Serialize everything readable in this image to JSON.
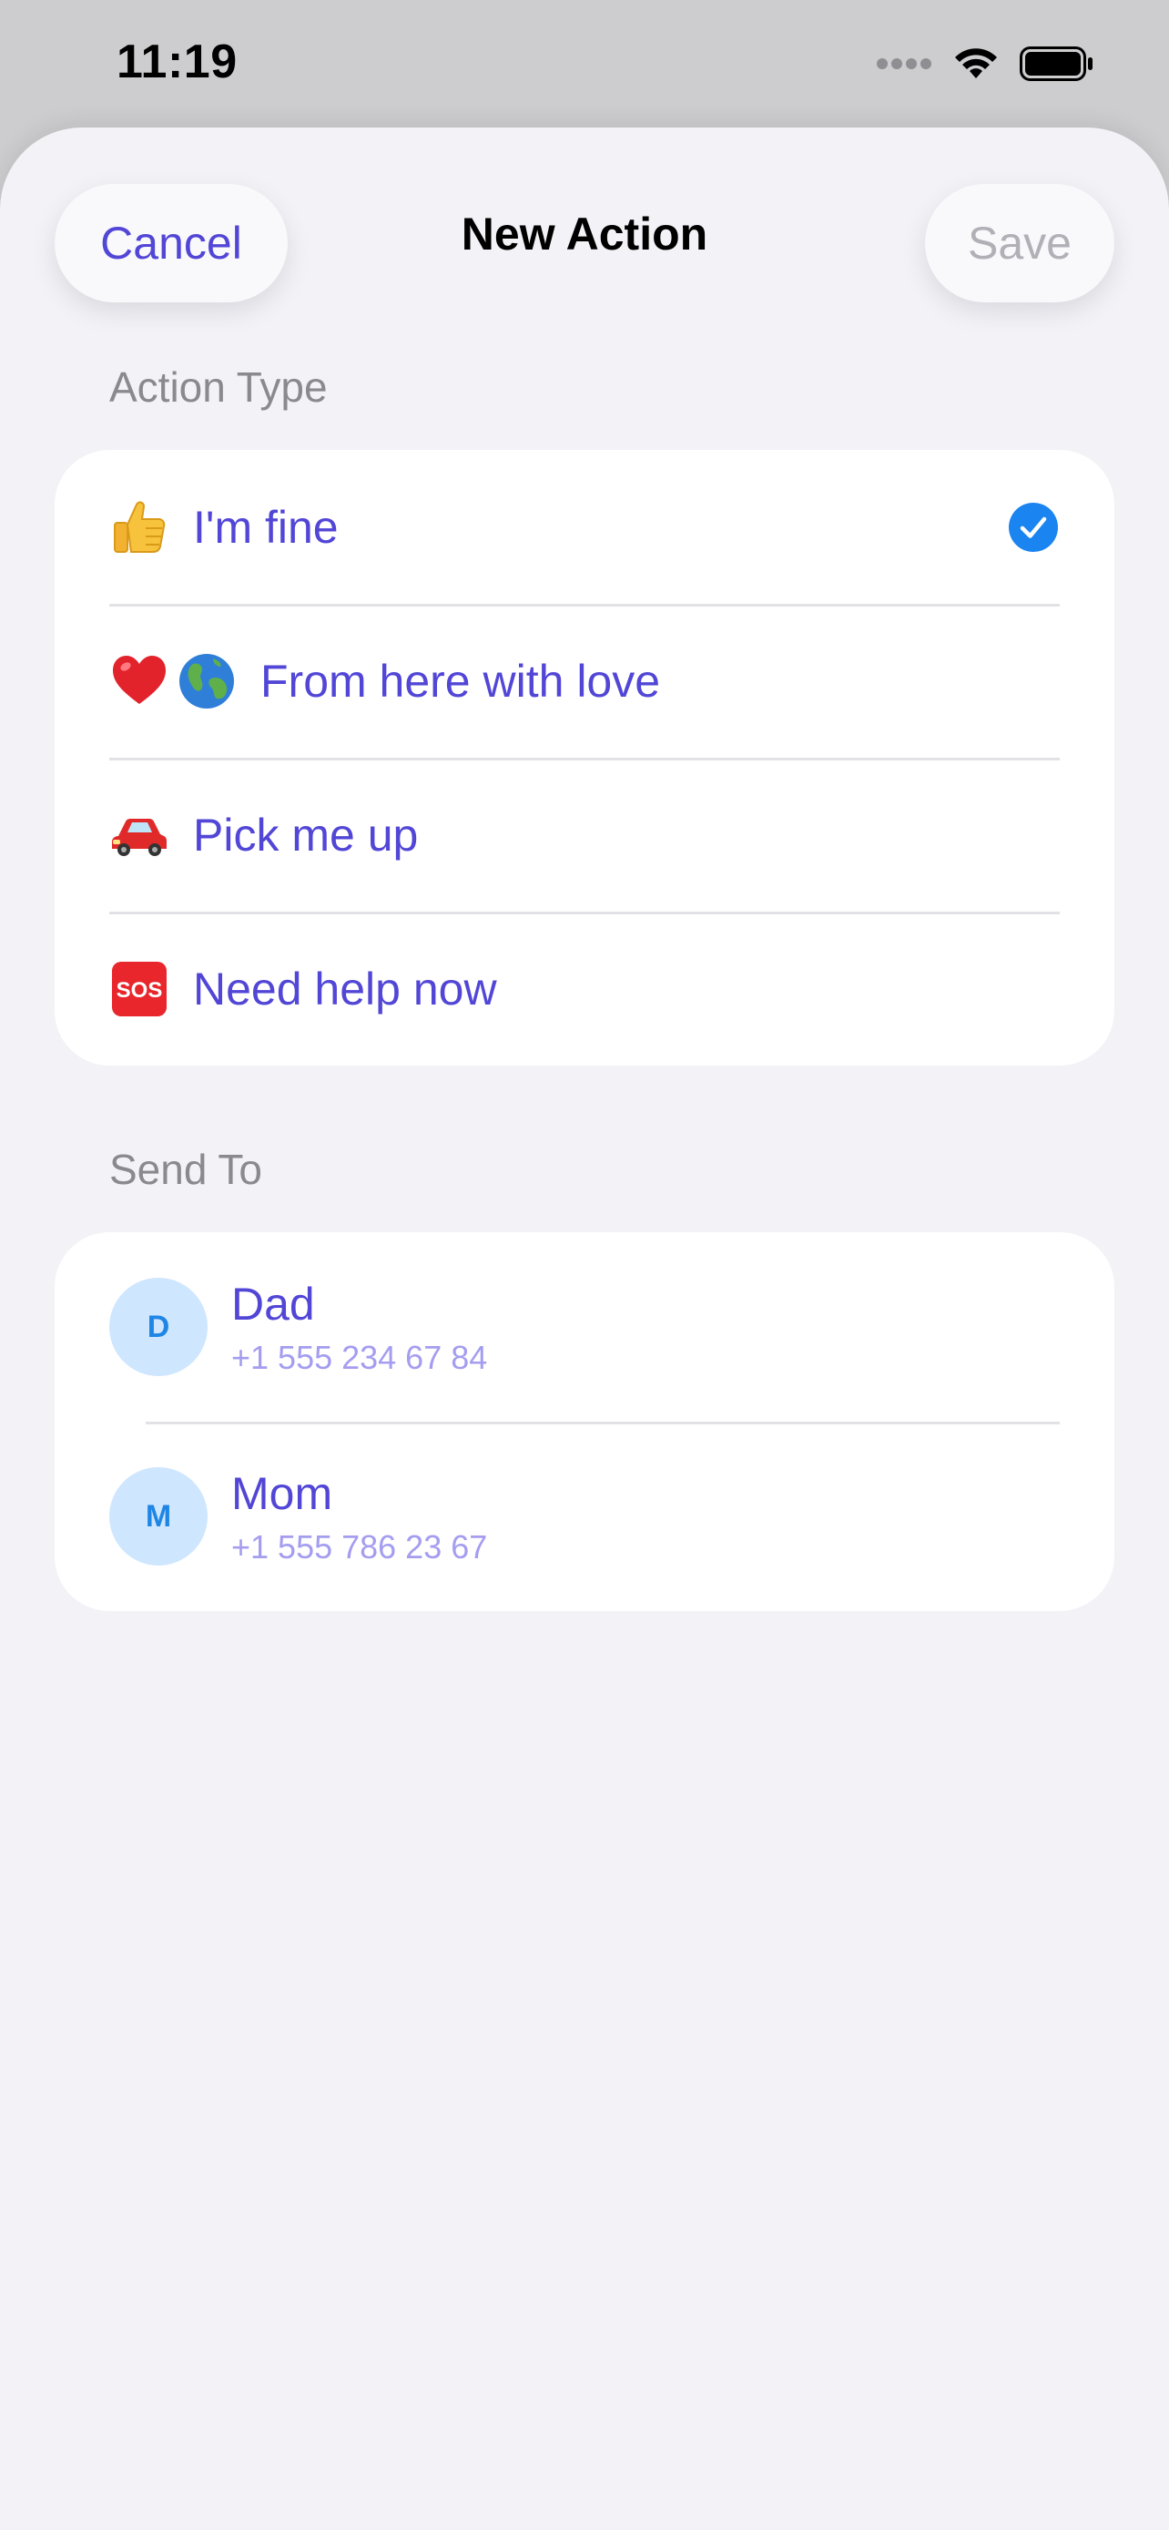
{
  "status_bar": {
    "time": "11:19",
    "icons": [
      "signal-dots-icon",
      "wifi-icon",
      "battery-icon"
    ]
  },
  "nav": {
    "cancel_label": "Cancel",
    "title": "New Action",
    "save_label": "Save"
  },
  "action_type": {
    "header": "Action Type",
    "items": [
      {
        "icons": [
          "thumbs-up-icon"
        ],
        "label": "I'm fine",
        "selected": true
      },
      {
        "icons": [
          "red-heart-icon",
          "globe-icon"
        ],
        "label": "From here with love",
        "selected": false
      },
      {
        "icons": [
          "car-icon"
        ],
        "label": "Pick me up",
        "selected": false
      },
      {
        "icons": [
          "sos-icon"
        ],
        "label": "Need help now",
        "selected": false
      }
    ]
  },
  "send_to": {
    "header": "Send To",
    "contacts": [
      {
        "initial": "D",
        "name": "Dad",
        "phone": "+1 555 234 67 84"
      },
      {
        "initial": "M",
        "name": "Mom",
        "phone": "+1 555 786 23 67"
      }
    ]
  },
  "colors": {
    "accent": "#5246d6",
    "checkmark": "#1a84f0",
    "avatar_bg": "#cfe6ff",
    "avatar_text": "#1f86e6",
    "secondary_text": "#a49df0",
    "save_disabled": "#b0b0b6"
  }
}
